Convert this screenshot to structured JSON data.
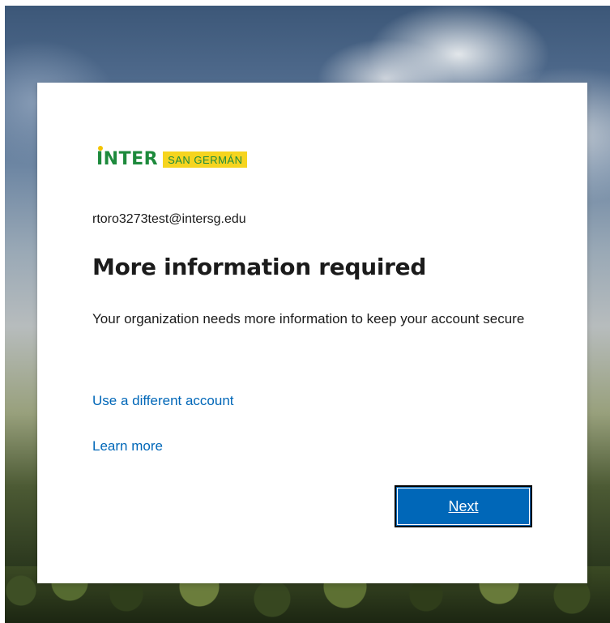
{
  "logo": {
    "inter": "INTER",
    "campus": "SAN GERMÁN"
  },
  "account": {
    "email": "rtoro3273test@intersg.edu"
  },
  "main": {
    "title": "More information required",
    "description": "Your organization needs more information to keep your account secure",
    "links": {
      "different_account": "Use a different account",
      "learn_more": "Learn more"
    },
    "next_label": "Next"
  },
  "colors": {
    "link": "#0067b8",
    "button_bg": "#0067b8",
    "logo_green": "#1d8a3c",
    "logo_yellow": "#f6d41f"
  }
}
